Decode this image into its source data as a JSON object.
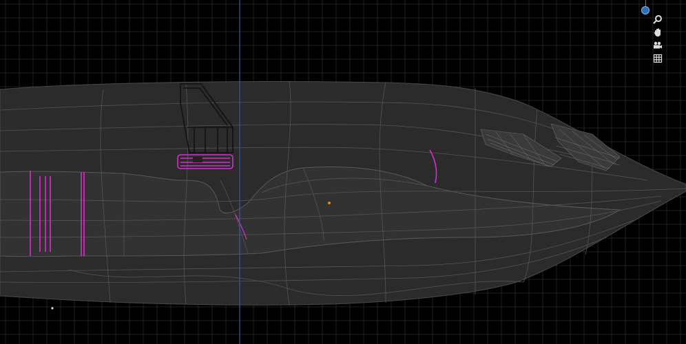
{
  "viewport": {
    "mode": "edit-wireframe",
    "colors": {
      "background": "#000000",
      "grid": "#3a3a3a",
      "hull_fill": "#2a2a2a",
      "wire": "#555555",
      "selection": "#d82fd0",
      "x_axis_line": "#3d5aa8",
      "origin_dot": "#e08a2a"
    }
  },
  "gizmos": {
    "axis_icon": "axis-z-dot",
    "zoom_icon": "magnifier-icon",
    "pan_icon": "hand-icon",
    "camera_icon": "camera-icon",
    "ortho_icon": "grid-icon"
  }
}
